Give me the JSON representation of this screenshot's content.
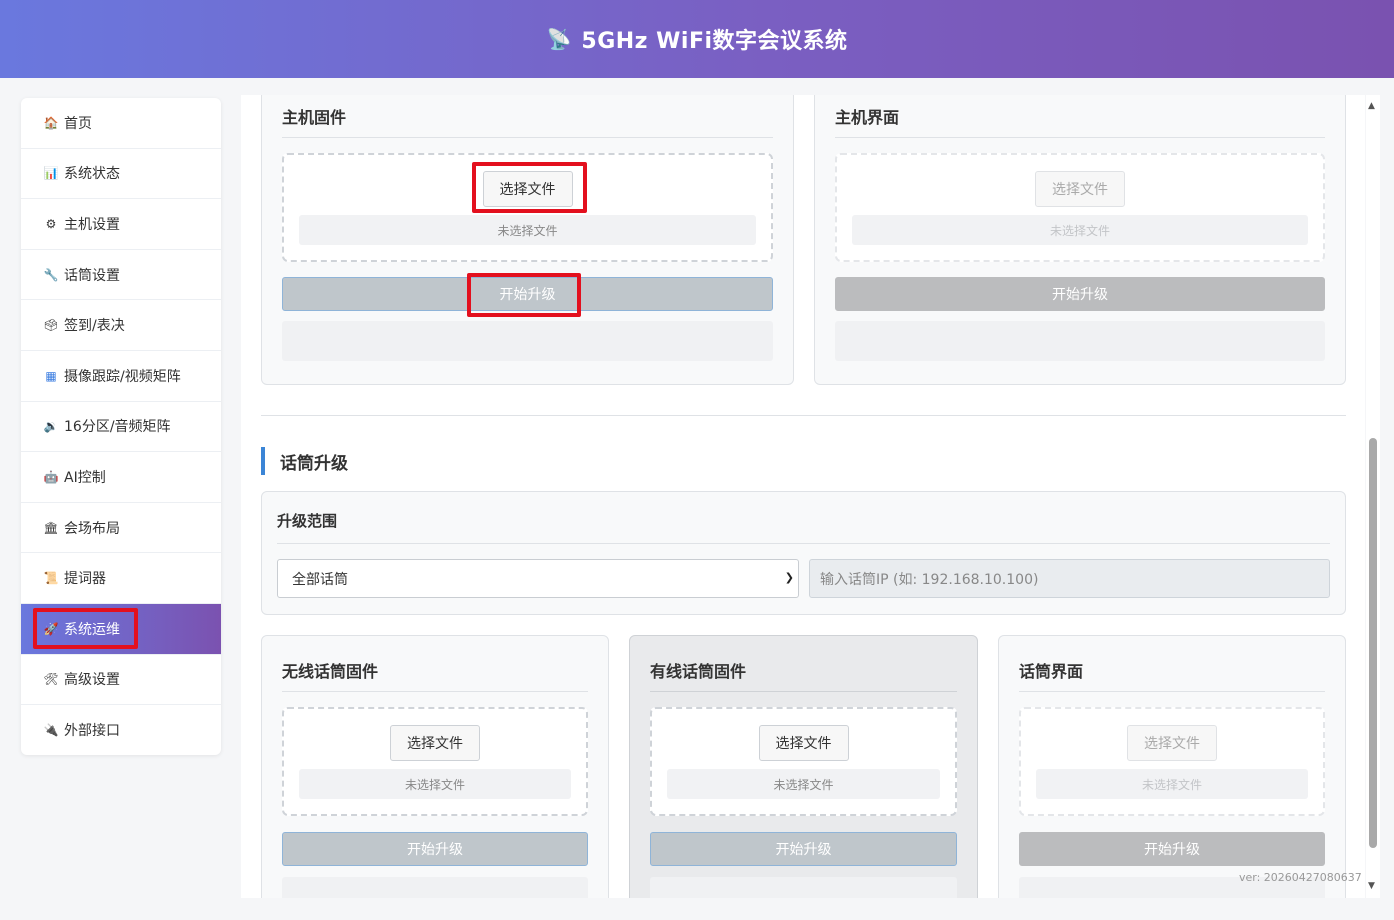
{
  "header": {
    "logo_icon": "satellite-dish-icon",
    "logo_glyph": "📡",
    "title": "5GHz WiFi数字会议系统"
  },
  "sidebar": {
    "items": [
      {
        "label": "首页",
        "icon": "home-icon",
        "glyph": "🏠"
      },
      {
        "label": "系统状态",
        "icon": "chart-icon",
        "glyph": "📊"
      },
      {
        "label": "主机设置",
        "icon": "gear-icon",
        "glyph": "⚙"
      },
      {
        "label": "话筒设置",
        "icon": "wrench-icon",
        "glyph": "🔧"
      },
      {
        "label": "签到/表决",
        "icon": "vote-icon",
        "glyph": "🗳"
      },
      {
        "label": "摄像跟踪/视频矩阵",
        "icon": "camera-grid-icon",
        "glyph": "▦"
      },
      {
        "label": "16分区/音频矩阵",
        "icon": "speaker-icon",
        "glyph": "🔉"
      },
      {
        "label": "AI控制",
        "icon": "robot-icon",
        "glyph": "🤖"
      },
      {
        "label": "会场布局",
        "icon": "building-icon",
        "glyph": "🏛"
      },
      {
        "label": "提词器",
        "icon": "scroll-icon",
        "glyph": "📜"
      },
      {
        "label": "系统运维",
        "icon": "rocket-icon",
        "glyph": "🚀",
        "active": true
      },
      {
        "label": "高级设置",
        "icon": "tools-icon",
        "glyph": "🛠"
      },
      {
        "label": "外部接口",
        "icon": "plug-icon",
        "glyph": "🔌"
      }
    ]
  },
  "host_firmware": {
    "title": "主机固件",
    "choose_label": "选择文件",
    "file_status": "未选择文件",
    "upgrade_label": "开始升级"
  },
  "host_ui": {
    "title": "主机界面",
    "choose_label": "选择文件",
    "file_status": "未选择文件",
    "upgrade_label": "开始升级"
  },
  "mic_section": {
    "title": "话筒升级",
    "scope": {
      "title": "升级范围",
      "selected": "全部话筒",
      "ip_placeholder": "输入话筒IP (如: 192.168.10.100)"
    },
    "wireless": {
      "title": "无线话筒固件",
      "choose_label": "选择文件",
      "file_status": "未选择文件",
      "upgrade_label": "开始升级"
    },
    "wired": {
      "title": "有线话筒固件",
      "choose_label": "选择文件",
      "file_status": "未选择文件",
      "upgrade_label": "开始升级"
    },
    "mic_ui": {
      "title": "话筒界面",
      "choose_label": "选择文件",
      "file_status": "未选择文件",
      "upgrade_label": "开始升级"
    }
  },
  "version": "ver: 20260427080637",
  "colors": {
    "header_start": "#6a78de",
    "header_end": "#7a52b0",
    "accent_bar": "#3b85d6",
    "highlight_box": "#e3101e"
  }
}
